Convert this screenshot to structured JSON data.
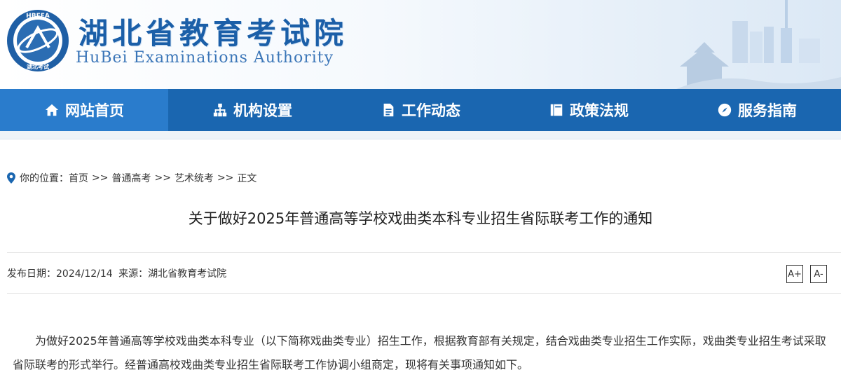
{
  "header": {
    "site_name": "湖北省教育考试院",
    "site_name_en": "HuBei Examinations Authority",
    "logo_ring_text": "HBEEA",
    "logo_bottom_text": "湖北考试"
  },
  "nav": {
    "items": [
      {
        "label": "网站首页",
        "icon": "home-icon"
      },
      {
        "label": "机构设置",
        "icon": "org-chart-icon"
      },
      {
        "label": "工作动态",
        "icon": "document-icon"
      },
      {
        "label": "政策法规",
        "icon": "book-icon"
      },
      {
        "label": "服务指南",
        "icon": "compass-icon"
      }
    ]
  },
  "breadcrumb": {
    "prefix": "你的位置：",
    "items": [
      "首页",
      "普通高考",
      "艺术统考",
      "正文"
    ],
    "separator": ">>"
  },
  "article": {
    "title": "关于做好2025年普通高等学校戏曲类本科专业招生省际联考工作的通知",
    "meta": {
      "date_label": "发布日期：",
      "date": "2024/12/14",
      "source_label": "来源：",
      "source": "湖北省教育考试院"
    },
    "font_increase": "A+",
    "font_decrease": "A-",
    "paragraph": "为做好2025年普通高等学校戏曲类本科专业（以下简称戏曲类专业）招生工作，根据教育部有关规定，结合戏曲类专业招生工作实际，戏曲类专业招生考试采取省际联考的形式举行。经普通高校戏曲类专业招生省际联考工作协调小组商定，现将有关事项通知如下。"
  },
  "colors": {
    "brand_blue": "#1a66b0",
    "nav_active": "#2a7ccc",
    "title_blue": "#1b5fa8"
  }
}
